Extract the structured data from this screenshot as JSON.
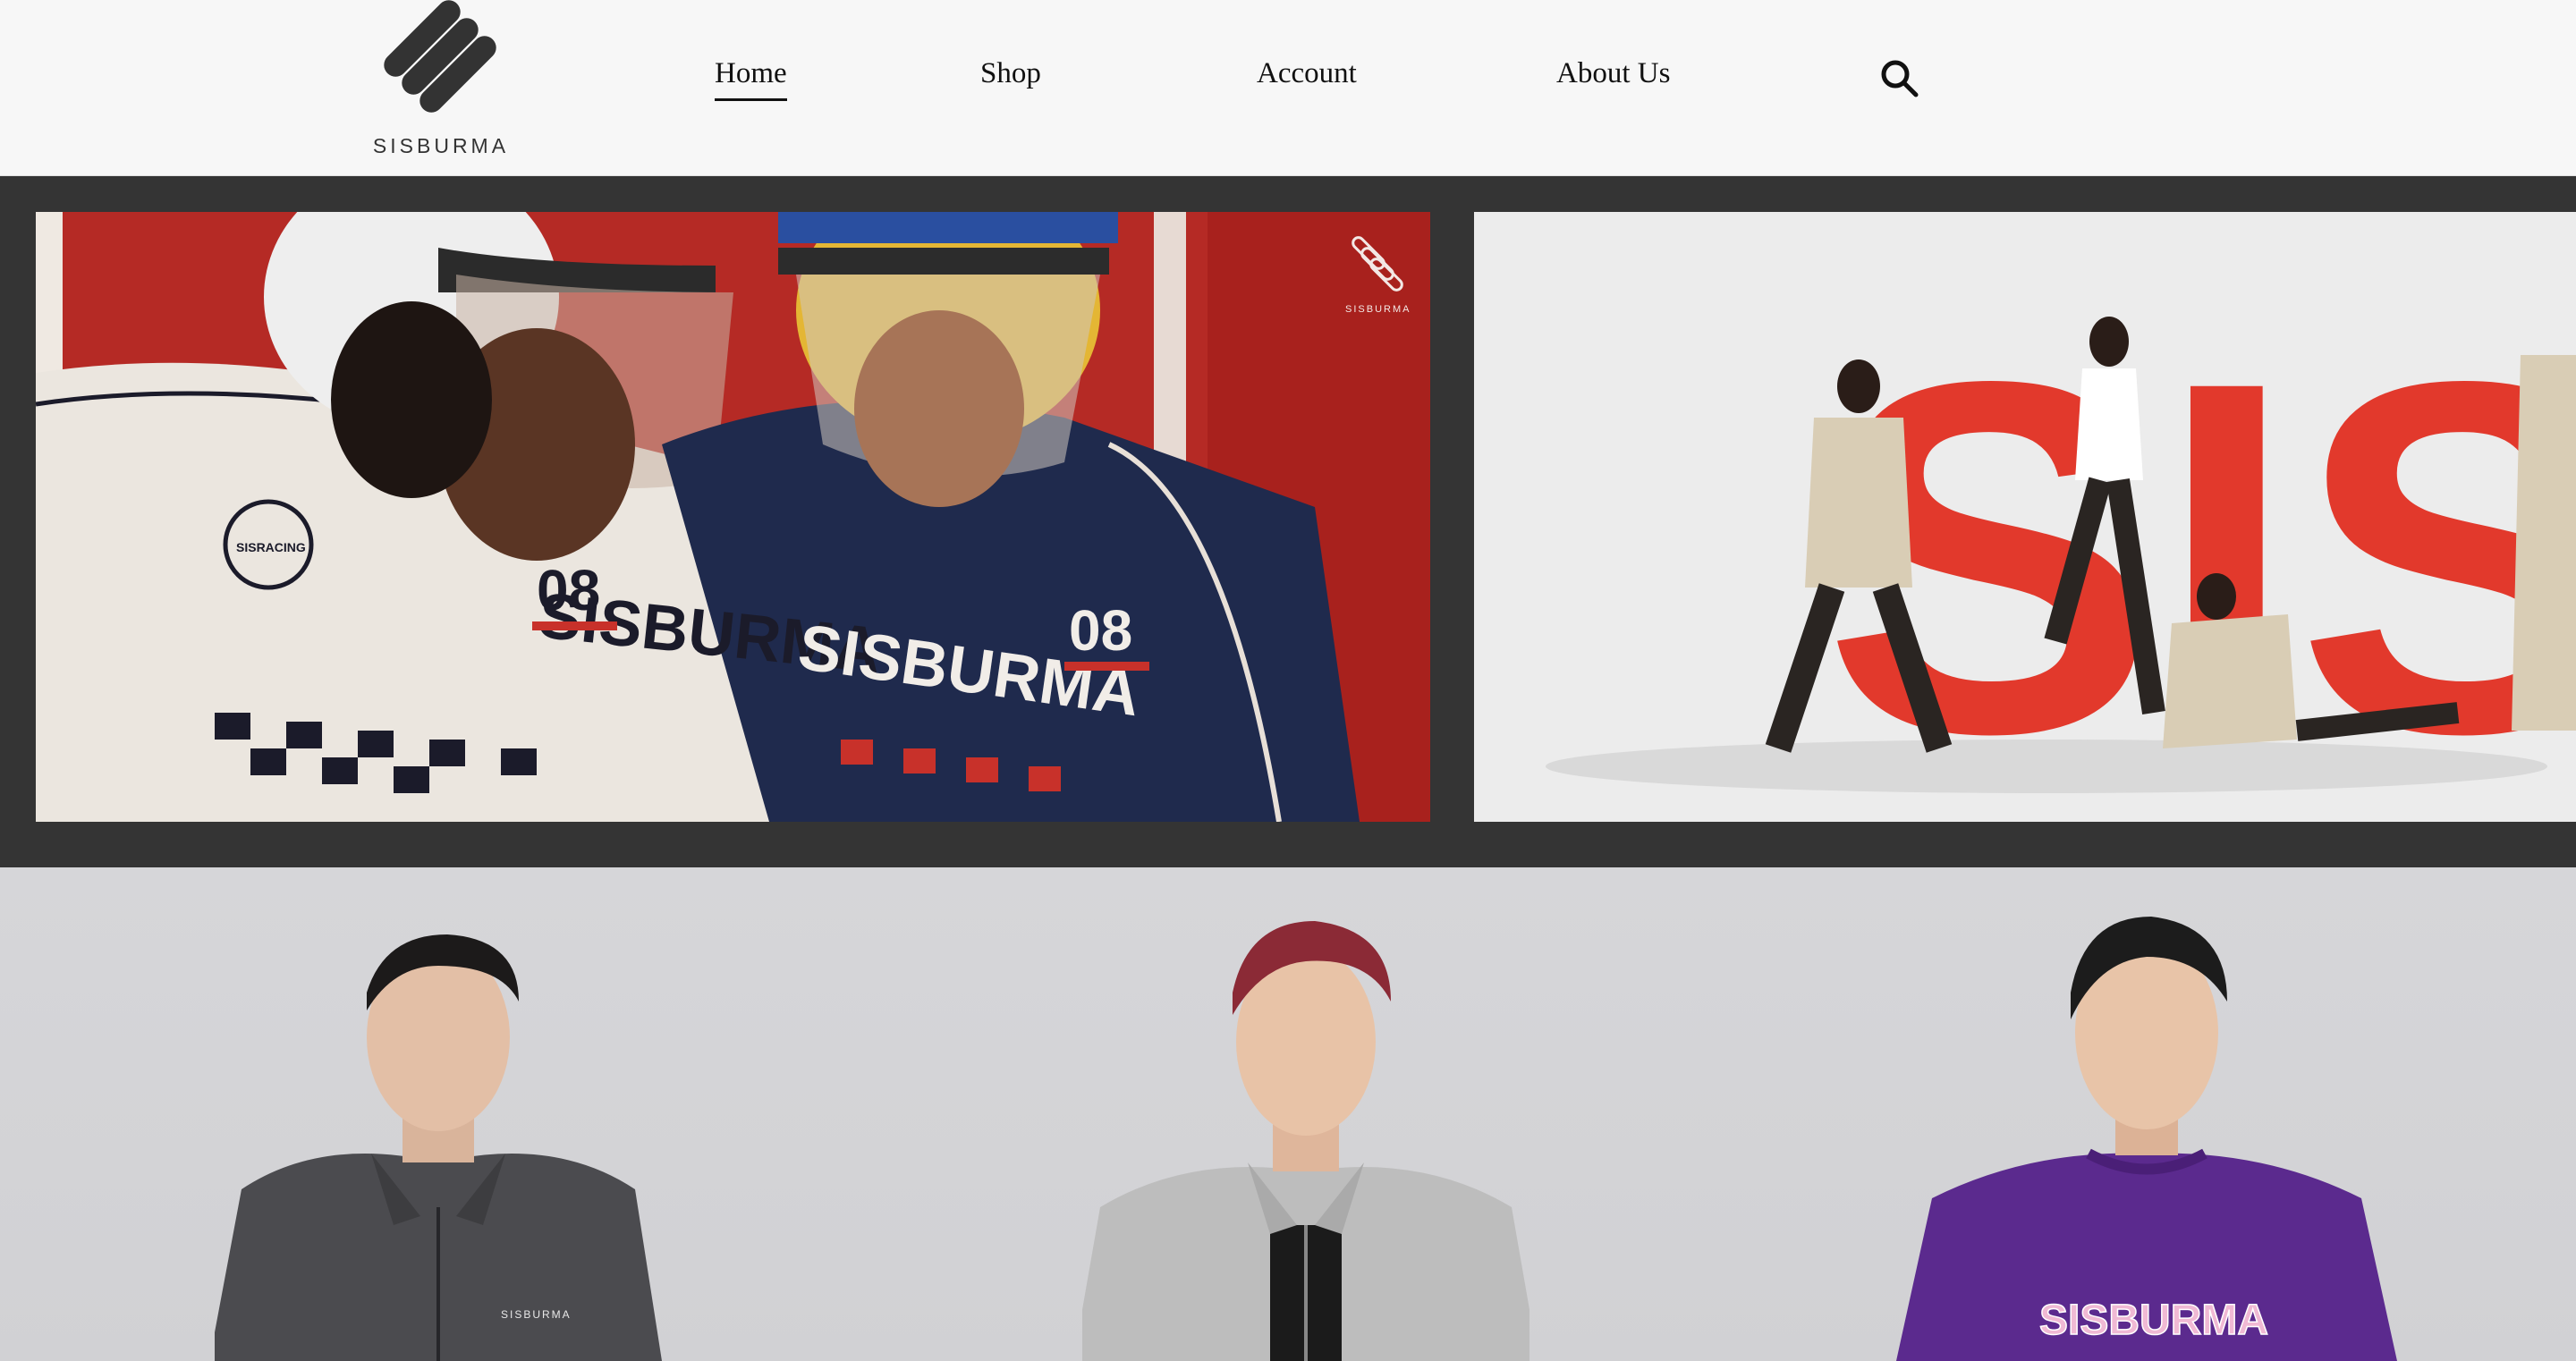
{
  "header": {
    "brand": "SISBURMA",
    "logo_icon": "three-diagonal-bars-logo",
    "nav": [
      {
        "label": "Home",
        "active": true
      },
      {
        "label": "Shop",
        "active": false
      },
      {
        "label": "Account",
        "active": false
      },
      {
        "label": "About Us",
        "active": false
      }
    ],
    "search_icon": "search-icon"
  },
  "hero": {
    "slides": [
      {
        "jersey_text": "SISBURMA",
        "number": "08",
        "watermark": "SISBURMA",
        "badge": "SISRACING"
      },
      {
        "backdrop_letters": "SIS"
      }
    ]
  },
  "models": {
    "apparel_print_center": "SISBURMA"
  },
  "colors": {
    "header_bg": "#f7f7f7",
    "band_dark": "#343434",
    "slide_red": "#b52a25",
    "letter_red": "#e2392c",
    "models_bg": "#d4d4d7",
    "purple": "#5b2a8e"
  }
}
